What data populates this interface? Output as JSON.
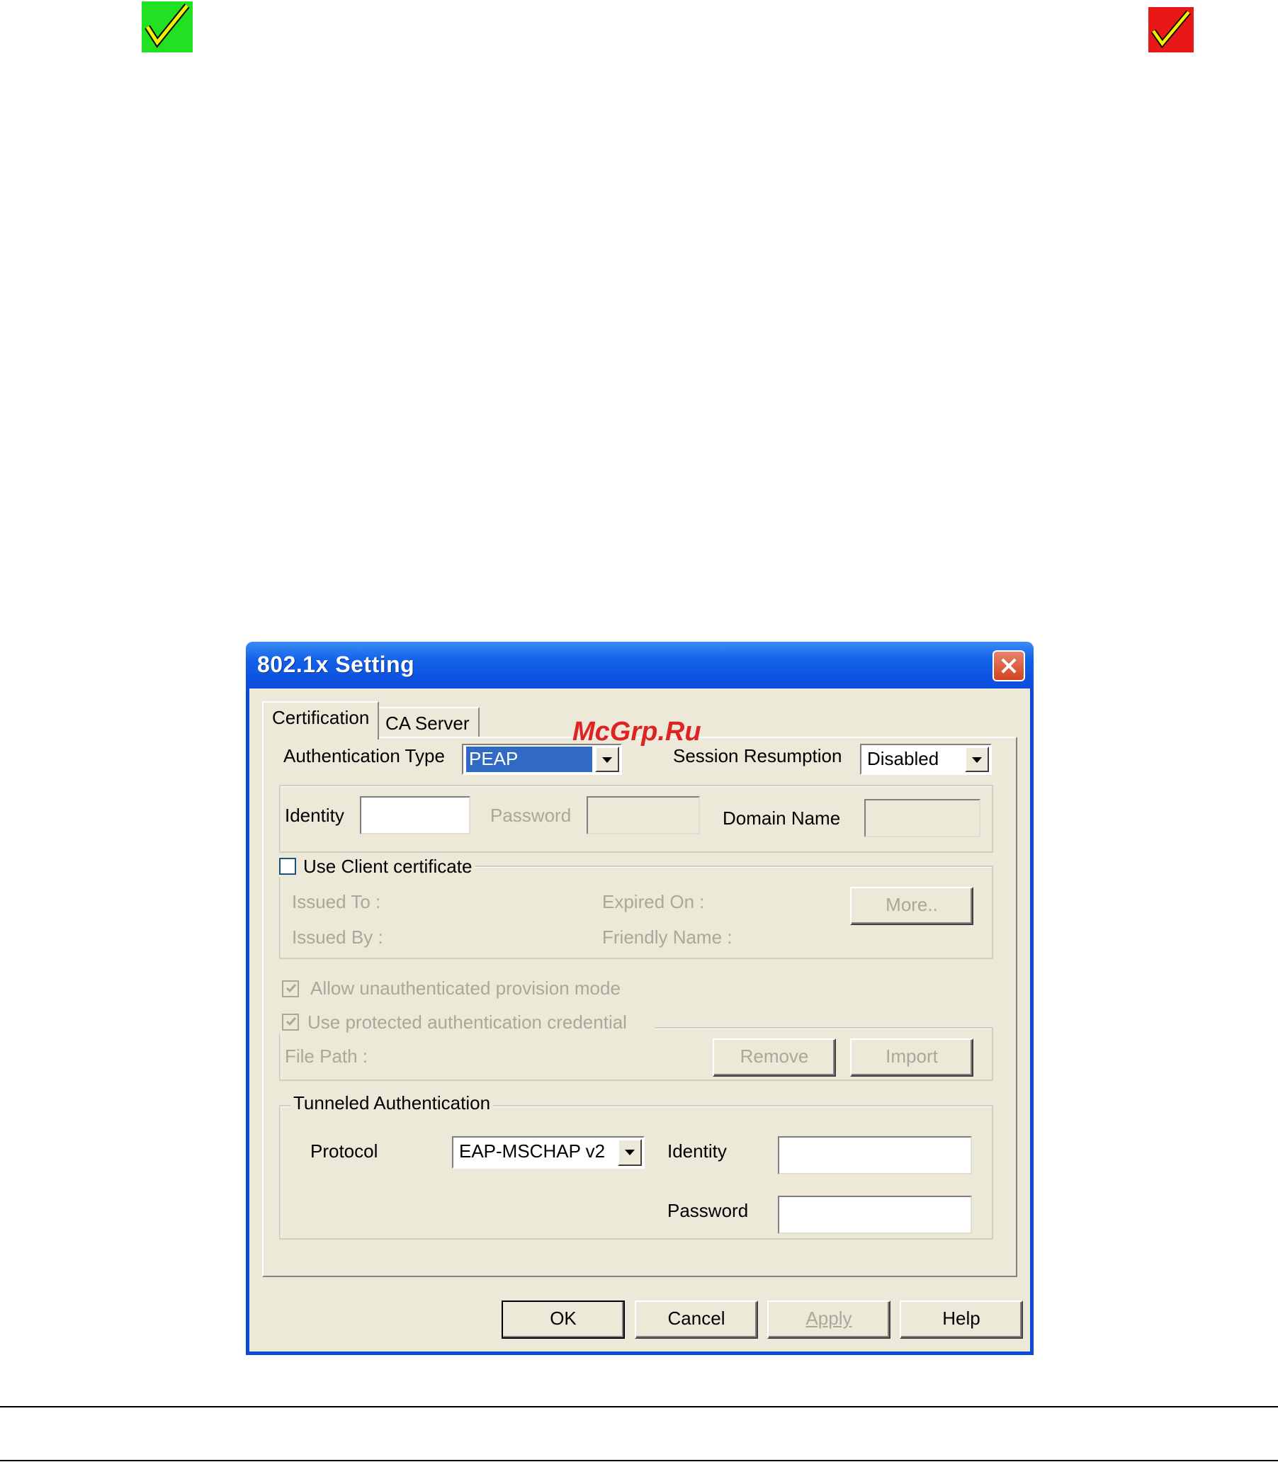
{
  "dialog": {
    "title": "802.1x Setting",
    "tabs": [
      {
        "label": "Certification"
      },
      {
        "label": "CA Server"
      }
    ],
    "auth_type_label": "Authentication Type",
    "auth_type_value": "PEAP",
    "session_resumption_label": "Session Resumption",
    "session_resumption_value": "Disabled",
    "identity_label": "Identity",
    "password_label": "Password",
    "domain_name_label": "Domain Name",
    "use_client_cert_label": "Use Client certificate",
    "issued_to_label": "Issued To :",
    "expired_on_label": "Expired On :",
    "issued_by_label": "Issued By :",
    "friendly_name_label": "Friendly Name :",
    "more_button": "More..",
    "allow_unauth_label": "Allow unauthenticated provision mode",
    "use_protected_label": "Use protected authentication credential",
    "file_path_label": "File Path :",
    "remove_button": "Remove",
    "import_button": "Import",
    "tunneled": {
      "legend": "Tunneled Authentication",
      "protocol_label": "Protocol",
      "protocol_value": "EAP-MSCHAP v2",
      "identity_label": "Identity",
      "password_label": "Password"
    },
    "buttons": {
      "ok": "OK",
      "cancel": "Cancel",
      "apply": "Apply",
      "help": "Help"
    }
  },
  "watermark": "McGrp.Ru",
  "colors": {
    "green_check_bg": "#22e022",
    "red_check_bg": "#e81818",
    "titlebar": "#0b4ddc",
    "dialog_face": "#ece9d8"
  }
}
